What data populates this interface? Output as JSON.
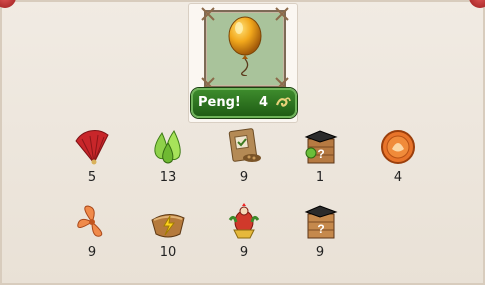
{
  "reward": {
    "name": "Peng!",
    "count": "4",
    "icon": "golden-balloon-icon"
  },
  "items_row1": [
    {
      "icon": "fan-icon",
      "qty": "5"
    },
    {
      "icon": "green-drops-icon",
      "qty": "13"
    },
    {
      "icon": "seed-packet-icon",
      "qty": "9"
    },
    {
      "icon": "mystery-crate-icon",
      "qty": "1"
    },
    {
      "icon": "coin-medallion-icon",
      "qty": "4"
    }
  ],
  "items_row2": [
    {
      "icon": "propeller-icon",
      "qty": "9"
    },
    {
      "icon": "energy-nest-icon",
      "qty": "10"
    },
    {
      "icon": "rooster-trophy-icon",
      "qty": "9"
    },
    {
      "icon": "mystery-crate-icon",
      "qty": "9"
    }
  ],
  "colors": {
    "badge_green": "#2e7a21",
    "panel_bg": "#eee6dc"
  }
}
